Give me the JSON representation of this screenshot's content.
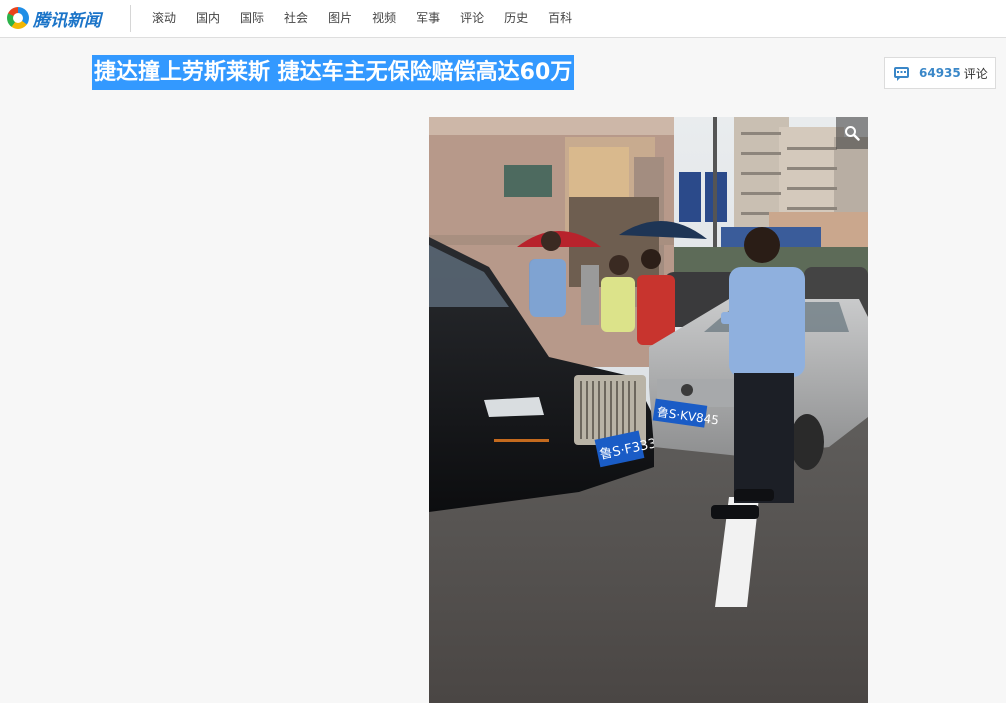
{
  "site": {
    "logo_text": "腾讯新闻",
    "brand_color": "#1b74c8"
  },
  "nav": {
    "items": [
      "滚动",
      "国内",
      "国际",
      "社会",
      "图片",
      "视频",
      "军事",
      "评论",
      "历史",
      "百科"
    ]
  },
  "article": {
    "title": "捷达撞上劳斯莱斯 捷达车主无保险赔偿高达60万",
    "highlight_color": "#3399ff"
  },
  "comments": {
    "count": "64935",
    "label": "评论",
    "icon": "comment-bubble-icon"
  },
  "photo": {
    "zoom_icon": "magnifier-icon",
    "plates": {
      "rolls_royce": "鲁S·F3333",
      "jetta": "鲁S·KV845"
    }
  }
}
